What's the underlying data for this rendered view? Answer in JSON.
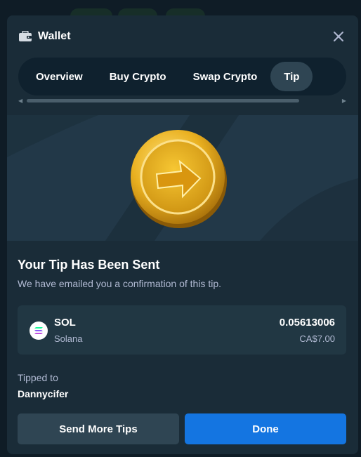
{
  "modal": {
    "title": "Wallet",
    "icon": "wallet-icon",
    "close_icon": "close-icon"
  },
  "tabs": [
    {
      "label": "Overview",
      "active": false
    },
    {
      "label": "Buy Crypto",
      "active": false
    },
    {
      "label": "Swap Crypto",
      "active": false
    },
    {
      "label": "Tip",
      "active": true
    }
  ],
  "hero": {
    "icon": "gold-coin-arrow-icon"
  },
  "confirmation": {
    "title": "Your Tip Has Been Sent",
    "subtitle": "We have emailed you a confirmation of this tip."
  },
  "coin": {
    "icon": "solana-icon",
    "symbol": "SOL",
    "name": "Solana",
    "amount": "0.05613006",
    "fiat": "CA$7.00"
  },
  "recipient": {
    "label": "Tipped to",
    "username": "Dannycifer"
  },
  "actions": {
    "secondary_label": "Send More Tips",
    "primary_label": "Done"
  },
  "colors": {
    "modal_bg": "#1a2c38",
    "tab_bar_bg": "#0f212e",
    "active_tab": "#2f4553",
    "primary_button": "#1475e1",
    "muted_text": "#b1bad3"
  }
}
